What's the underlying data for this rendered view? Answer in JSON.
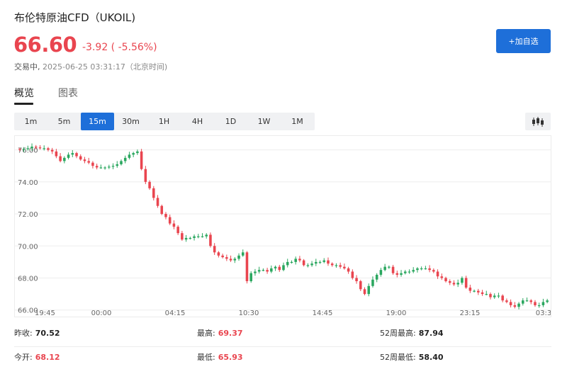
{
  "header": {
    "title": "布伦特原油CFD（UKOIL)",
    "price": "66.60",
    "change": "-3.92 ( -5.56%)",
    "status": "交易中,",
    "timestamp": "2025-06-25 03:31:17（北京时间)",
    "add_button": "+加自选"
  },
  "tabs": [
    {
      "label": "概览",
      "active": true
    },
    {
      "label": "图表",
      "active": false
    }
  ],
  "intervals": [
    {
      "label": "1m",
      "active": false
    },
    {
      "label": "5m",
      "active": false
    },
    {
      "label": "15m",
      "active": true
    },
    {
      "label": "30m",
      "active": false
    },
    {
      "label": "1H",
      "active": false
    },
    {
      "label": "4H",
      "active": false
    },
    {
      "label": "1D",
      "active": false
    },
    {
      "label": "1W",
      "active": false
    },
    {
      "label": "1M",
      "active": false
    }
  ],
  "chart_icon": "candlestick-icon",
  "colors": {
    "up": "#2aa75f",
    "down": "#e9454f",
    "accent": "#1e6fd9"
  },
  "chart_data": {
    "type": "candlestick",
    "y_ticks": [
      "76.00",
      "74.00",
      "72.00",
      "70.00",
      "68.00",
      "66.00"
    ],
    "x_ticks": [
      "19:45",
      "00:00",
      "04:15",
      "10:30",
      "14:45",
      "19:00",
      "23:15",
      "03:3"
    ],
    "ylim": [
      65.9,
      76.6
    ],
    "grid": true,
    "closes": [
      76.0,
      76.05,
      76.1,
      76.2,
      76.15,
      76.1,
      76.1,
      76.0,
      75.9,
      75.6,
      75.3,
      75.5,
      75.7,
      75.8,
      75.6,
      75.4,
      75.3,
      75.2,
      75.0,
      74.9,
      74.9,
      74.9,
      74.95,
      75.0,
      75.1,
      75.3,
      75.5,
      75.7,
      75.8,
      75.9,
      74.8,
      74.0,
      73.6,
      73.0,
      72.5,
      72.0,
      71.8,
      71.4,
      71.2,
      70.8,
      70.4,
      70.5,
      70.5,
      70.6,
      70.6,
      70.6,
      70.7,
      70.0,
      69.6,
      69.4,
      69.3,
      69.2,
      69.1,
      69.2,
      69.4,
      69.6,
      67.8,
      68.3,
      68.4,
      68.5,
      68.5,
      68.4,
      68.6,
      68.7,
      68.5,
      68.8,
      69.0,
      69.0,
      69.2,
      69.1,
      68.8,
      68.8,
      68.9,
      69.0,
      69.0,
      69.1,
      68.9,
      68.8,
      68.8,
      68.7,
      68.6,
      68.4,
      68.0,
      67.8,
      67.3,
      67.0,
      67.5,
      67.9,
      68.2,
      68.5,
      68.7,
      68.7,
      68.3,
      68.2,
      68.3,
      68.4,
      68.4,
      68.5,
      68.6,
      68.6,
      68.6,
      68.5,
      68.4,
      68.1,
      68.0,
      67.8,
      67.7,
      67.6,
      67.7,
      68.0,
      67.4,
      67.2,
      67.2,
      67.1,
      67.0,
      67.0,
      66.8,
      66.9,
      66.9,
      66.6,
      66.5,
      66.3,
      66.2,
      66.4,
      66.6,
      66.6,
      66.5,
      66.3,
      66.3,
      66.5,
      66.6
    ]
  },
  "stats": {
    "row1": [
      {
        "label": "昨收:",
        "value": "70.52",
        "color": "neutral"
      },
      {
        "label": "最高:",
        "value": "69.37",
        "color": "red"
      },
      {
        "label": "52周最高:",
        "value": "87.94",
        "color": "neutral"
      }
    ],
    "row2": [
      {
        "label": "今开:",
        "value": "68.12",
        "color": "red"
      },
      {
        "label": "最低:",
        "value": "65.93",
        "color": "red"
      },
      {
        "label": "52周最低:",
        "value": "58.40",
        "color": "neutral"
      }
    ]
  }
}
